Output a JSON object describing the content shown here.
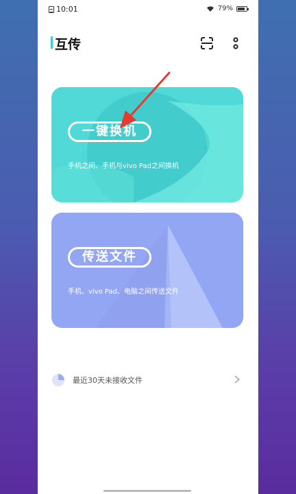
{
  "status_bar": {
    "time": "10:01",
    "battery_percent": "79%"
  },
  "header": {
    "title": "互传"
  },
  "cards": [
    {
      "label": "一键换机",
      "description": "手机之间、手机与vivo Pad之间换机",
      "color": "#50d9d6"
    },
    {
      "label": "传送文件",
      "description": "手机、vivo Pad、电脑之间传送文件",
      "color": "#92a6f4"
    }
  ],
  "recent": {
    "label": "最近30天未接收文件"
  },
  "icons": [
    "sim-icon",
    "wifi-icon",
    "battery-icon",
    "scan-icon",
    "more-icon",
    "pie-icon",
    "chevron-right-icon",
    "red-arrow-annotation"
  ],
  "colors": {
    "accent": "#3ad0d0",
    "annotation": "#e53a2f"
  }
}
